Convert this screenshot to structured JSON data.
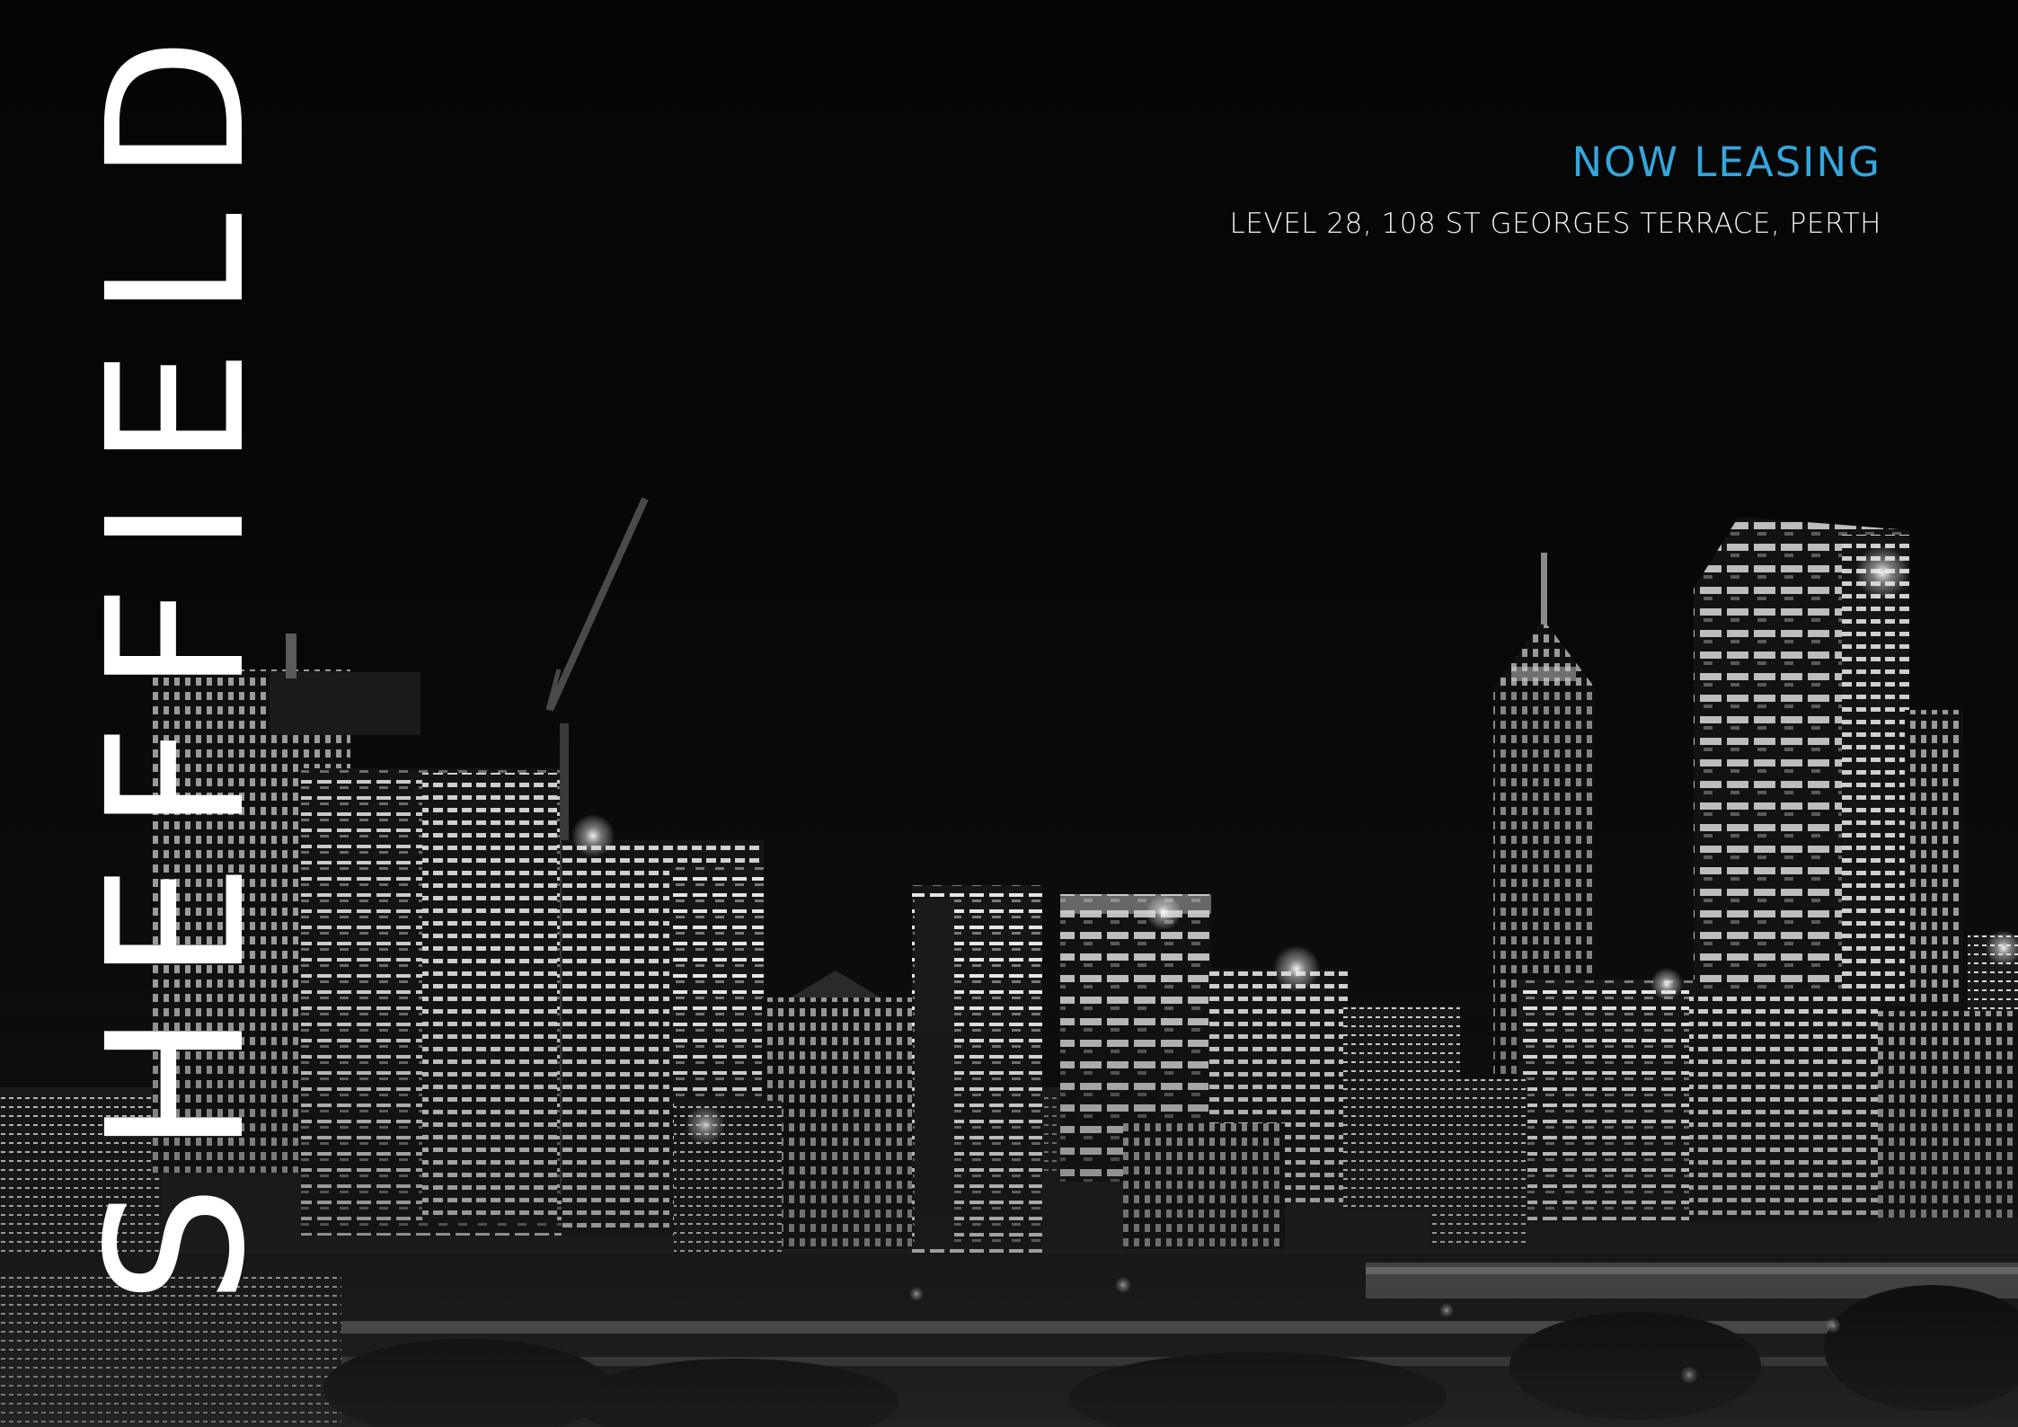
{
  "brand": {
    "title": "SHEFFIELD"
  },
  "listing": {
    "headline": "NOW LEASING",
    "address": "LEVEL 28, 108 ST GEORGES TERRACE, PERTH"
  },
  "colors": {
    "background": "#050505",
    "accent": "#34a6dc",
    "text": "#ffffff"
  },
  "image": {
    "subject": "night-city-skyline-photo"
  }
}
